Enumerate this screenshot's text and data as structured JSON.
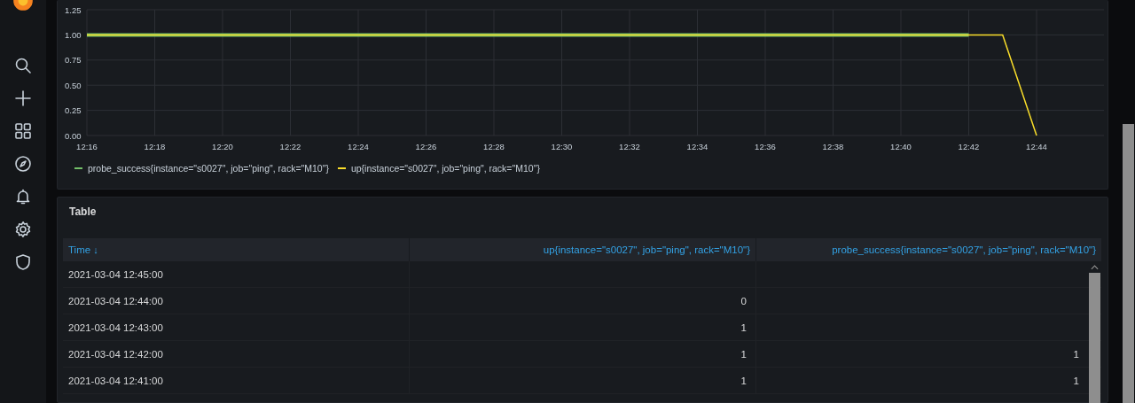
{
  "sidebar": {
    "items": [
      {
        "kind": "search"
      },
      {
        "kind": "create"
      },
      {
        "kind": "dashboards"
      },
      {
        "kind": "explore"
      },
      {
        "kind": "alerting"
      },
      {
        "kind": "configuration"
      },
      {
        "kind": "admin"
      }
    ]
  },
  "graph_panel": {
    "chart_data": {
      "type": "line",
      "grid": true,
      "categories": [
        "12:16",
        null,
        "12:18",
        null,
        "12:20",
        null,
        "12:22",
        null,
        "12:24",
        null,
        "12:26",
        null,
        "12:28",
        null,
        "12:30",
        null,
        "12:32",
        null,
        "12:34",
        null,
        "12:36",
        null,
        "12:38",
        null,
        "12:40",
        null,
        "12:42",
        null,
        "12:44"
      ],
      "series": [
        {
          "name": "probe_success{instance=\"s0027\", job=\"ping\", rack=\"M10\"}",
          "color": "#73bf69",
          "values": [
            1,
            1,
            1,
            1,
            1,
            1,
            1,
            1,
            1,
            1,
            1,
            1,
            1,
            1,
            1,
            1,
            1,
            1,
            1,
            1,
            1,
            1,
            1,
            1,
            1,
            1,
            1,
            null,
            null
          ]
        },
        {
          "name": "up{instance=\"s0027\", job=\"ping\", rack=\"M10\"}",
          "color": "#fade2a",
          "values": [
            1,
            1,
            1,
            1,
            1,
            1,
            1,
            1,
            1,
            1,
            1,
            1,
            1,
            1,
            1,
            1,
            1,
            1,
            1,
            1,
            1,
            1,
            1,
            1,
            1,
            1,
            1,
            1,
            0
          ]
        }
      ],
      "ylim": [
        0,
        1.25
      ],
      "yticks": [
        {
          "value": 0,
          "label": "0.00"
        },
        {
          "value": 0.25,
          "label": "0.25"
        },
        {
          "value": 0.5,
          "label": "0.50"
        },
        {
          "value": 0.75,
          "label": "0.75"
        },
        {
          "value": 1,
          "label": "1.00"
        },
        {
          "value": 1.25,
          "label": "1.25"
        }
      ]
    }
  },
  "table_panel": {
    "title": "Table",
    "columns": [
      {
        "label": "Time",
        "sort_icon": "↓"
      },
      {
        "label": "up{instance=\"s0027\", job=\"ping\", rack=\"M10\"}"
      },
      {
        "label": "probe_success{instance=\"s0027\", job=\"ping\", rack=\"M10\"}"
      }
    ],
    "rows": [
      {
        "cells": [
          "2021-03-04 12:45:00",
          null,
          null
        ]
      },
      {
        "cells": [
          "2021-03-04 12:44:00",
          "0",
          null
        ]
      },
      {
        "cells": [
          "2021-03-04 12:43:00",
          "1",
          null
        ]
      },
      {
        "cells": [
          "2021-03-04 12:42:00",
          "1",
          "1"
        ]
      },
      {
        "cells": [
          "2021-03-04 12:41:00",
          "1",
          "1"
        ]
      }
    ]
  }
}
